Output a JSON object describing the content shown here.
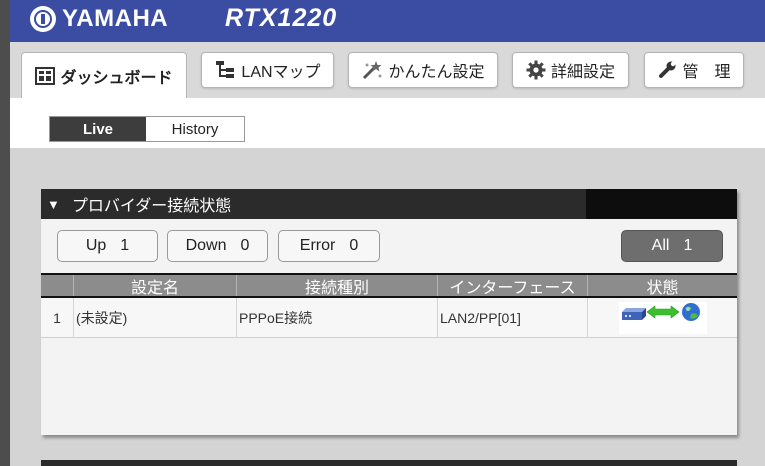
{
  "header": {
    "brand": "YAMAHA",
    "model": "RTX1220"
  },
  "tabs": [
    {
      "label": "ダッシュボード",
      "icon": "dashboard-icon",
      "active": true
    },
    {
      "label": "LANマップ",
      "icon": "lan-map-icon"
    },
    {
      "label": "かんたん設定",
      "icon": "magic-wand-icon"
    },
    {
      "label": "詳細設定",
      "icon": "gear-icon"
    },
    {
      "label": "管　理",
      "icon": "wrench-icon"
    }
  ],
  "view_toggle": {
    "live": "Live",
    "history": "History",
    "selected": "Live"
  },
  "panel": {
    "title": "プロバイダー接続状態",
    "counters": {
      "up_label": "Up",
      "up_count": "1",
      "down_label": "Down",
      "down_count": "0",
      "error_label": "Error",
      "error_count": "0",
      "all_label": "All",
      "all_count": "1"
    },
    "columns": [
      "設定名",
      "接続種別",
      "インターフェース",
      "状態"
    ],
    "rows": [
      {
        "index": "1",
        "name": "(未設定)",
        "type": "PPPoE接続",
        "interface": "LAN2/PP[01]",
        "status_icons": [
          "router-icon",
          "connected-arrow-icon",
          "globe-icon"
        ]
      }
    ]
  },
  "colors": {
    "header_blue": "#3b4da2",
    "status_green": "#3bbf2e",
    "panel_dark": "#2b2b2b"
  }
}
